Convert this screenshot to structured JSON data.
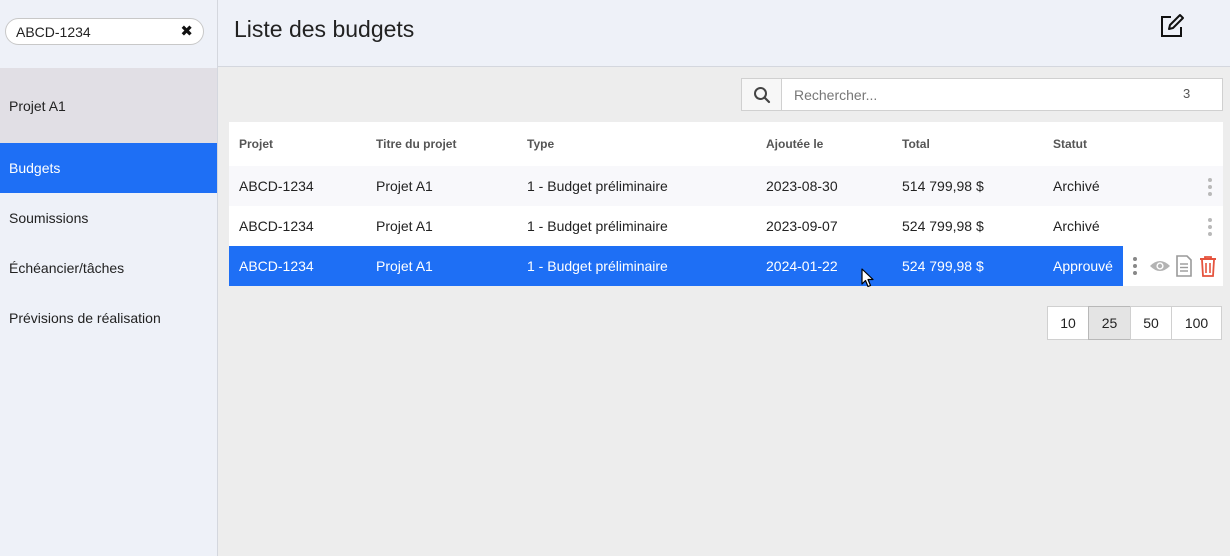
{
  "sidebar": {
    "search_value": "ABCD-1234",
    "project_name": "Projet A1",
    "items": [
      {
        "label": "Budgets",
        "active": true
      },
      {
        "label": "Soumissions",
        "active": false
      },
      {
        "label": "Échéancier/tâches",
        "active": false
      },
      {
        "label": "Prévisions de réalisation",
        "active": false
      }
    ]
  },
  "header": {
    "title": "Liste des budgets"
  },
  "search": {
    "placeholder": "Rechercher...",
    "count": "3"
  },
  "table": {
    "columns": [
      "Projet",
      "Titre du projet",
      "Type",
      "Ajoutée le",
      "Total",
      "Statut"
    ],
    "rows": [
      {
        "projet": "ABCD-1234",
        "titre": "Projet A1",
        "type": "1 - Budget préliminaire",
        "date": "2023-08-30",
        "total": "514 799,98 $",
        "statut": "Archivé"
      },
      {
        "projet": "ABCD-1234",
        "titre": "Projet A1",
        "type": "1 - Budget préliminaire",
        "date": "2023-09-07",
        "total": "524 799,98 $",
        "statut": "Archivé"
      },
      {
        "projet": "ABCD-1234",
        "titre": "Projet A1",
        "type": "1 - Budget préliminaire",
        "date": "2024-01-22",
        "total": "524 799,98 $",
        "statut": "Approuvé"
      }
    ]
  },
  "pagination": {
    "sizes": [
      "10",
      "25",
      "50",
      "100"
    ],
    "active": "25"
  },
  "icons": {
    "sidebar_clear": "close-icon",
    "header_edit": "edit-icon",
    "search": "search-icon",
    "row_menu": "more-vertical-icon",
    "view": "eye-icon",
    "document": "document-icon",
    "delete": "trash-icon"
  },
  "colors": {
    "accent": "#1e6ff5",
    "delete": "#e5533d"
  }
}
